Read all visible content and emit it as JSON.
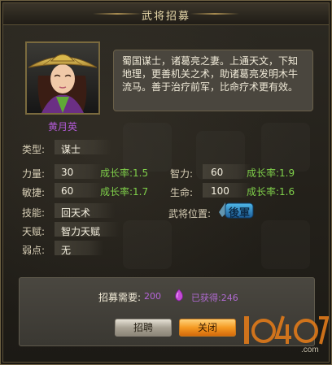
{
  "window": {
    "title": "武将招募"
  },
  "character": {
    "name": "黄月英",
    "description": "蜀国谋士，诸葛亮之妻。上通天文，下知地理，更善机关之术，助诸葛亮发明木牛流马。善于治疗前军，比命疗术更有效。"
  },
  "stats": {
    "type": {
      "label": "类型:",
      "value": "谋士"
    },
    "strength": {
      "label": "力量:",
      "value": "30",
      "growth": "成长率:1.5"
    },
    "intellect": {
      "label": "智力:",
      "value": "60",
      "growth": "成长率:1.9"
    },
    "agility": {
      "label": "敏捷:",
      "value": "60",
      "growth": "成长率:1.7"
    },
    "life": {
      "label": "生命:",
      "value": "100",
      "growth": "成长率:1.6"
    },
    "skill": {
      "label": "技能:",
      "value": "回天术"
    },
    "talent": {
      "label": "天赋:",
      "value": "智力天赋"
    },
    "weakness": {
      "label": "弱点:",
      "value": "无"
    },
    "position": {
      "label": "武将位置:",
      "value": "後軍"
    }
  },
  "recruit": {
    "required_label": "招募需要:",
    "required_value": "200",
    "owned_label": "已获得:",
    "owned_value": "246"
  },
  "buttons": {
    "recruit": "招聘",
    "close": "关闭"
  },
  "watermark": {
    "text": "1040",
    "suffix": ".com"
  },
  "colors": {
    "name": "#b25ad6",
    "growth": "#7fcf4a",
    "gem": "#c44ad6",
    "close_button": "#f59a22"
  }
}
